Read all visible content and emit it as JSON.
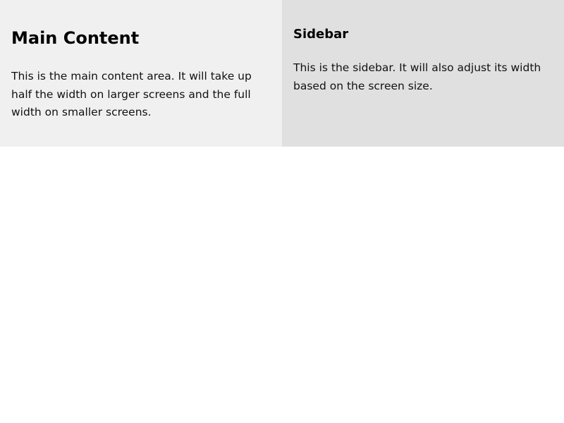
{
  "main": {
    "heading": "Main Content",
    "text": "This is the main content area. It will take up half the width on larger screens and the full width on smaller screens."
  },
  "sidebar": {
    "heading": "Sidebar",
    "text": "This is the sidebar. It will also adjust its width based on the screen size."
  },
  "colors": {
    "main_background": "#f0f0f0",
    "sidebar_background": "#e0e0e0",
    "page_background": "#ffffff"
  }
}
